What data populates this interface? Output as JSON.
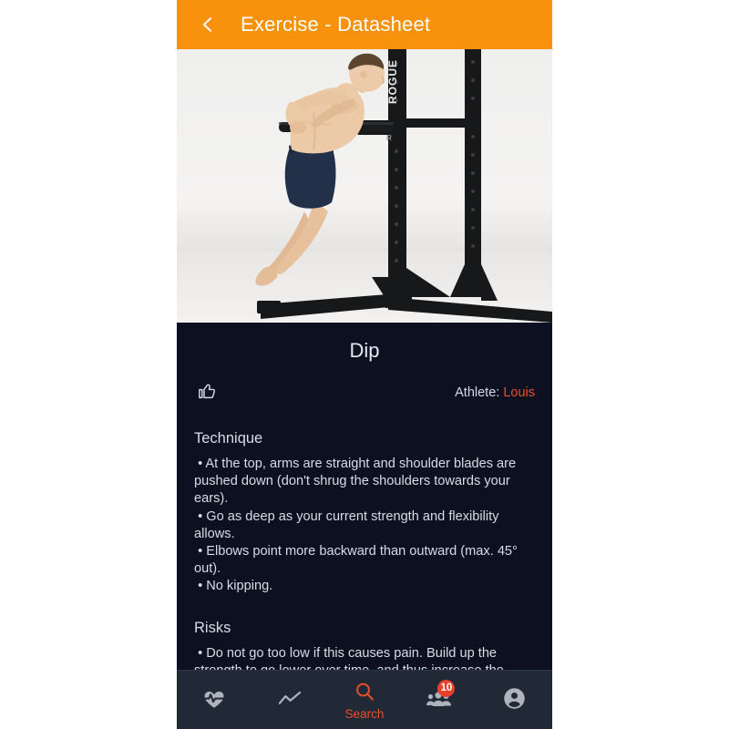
{
  "theme": {
    "header_orange": "#f8910c",
    "accent_orange_red": "#e8502a",
    "card_background": "#0c1020",
    "nav_background": "#212936",
    "badge_red": "#e8402a",
    "text_light": "#d9dce4"
  },
  "header": {
    "back_icon": "chevron-left-icon",
    "title": "Exercise - Datasheet"
  },
  "hero": {
    "alt": "Athlete performing a dip on a Rogue squat stand"
  },
  "exercise": {
    "title": "Dip",
    "like_icon": "thumbs-up-icon",
    "athlete_label": "Athlete:",
    "athlete_name": "Louis",
    "sections": [
      {
        "heading": "Technique",
        "body": " • At the top, arms are straight and shoulder blades are pushed down (don't shrug the shoulders towards your ears).\n • Go as deep as your current strength and flexibility allows.\n • Elbows point more backward than outward (max. 45° out).\n • No kipping."
      },
      {
        "heading": "Risks",
        "body": " • Do not go too low if this causes pain. Build up the strength to go lower over time, and thus increase the range of motion and the benefits."
      }
    ]
  },
  "bottom_nav": {
    "items": [
      {
        "icon": "heart-pulse-icon",
        "label": "",
        "active": false,
        "badge": ""
      },
      {
        "icon": "chart-line-icon",
        "label": "",
        "active": false,
        "badge": ""
      },
      {
        "icon": "search-icon",
        "label": "Search",
        "active": true,
        "badge": ""
      },
      {
        "icon": "friends-icon",
        "label": "",
        "active": false,
        "badge": "10"
      },
      {
        "icon": "account-circle-icon",
        "label": "",
        "active": false,
        "badge": ""
      }
    ]
  }
}
